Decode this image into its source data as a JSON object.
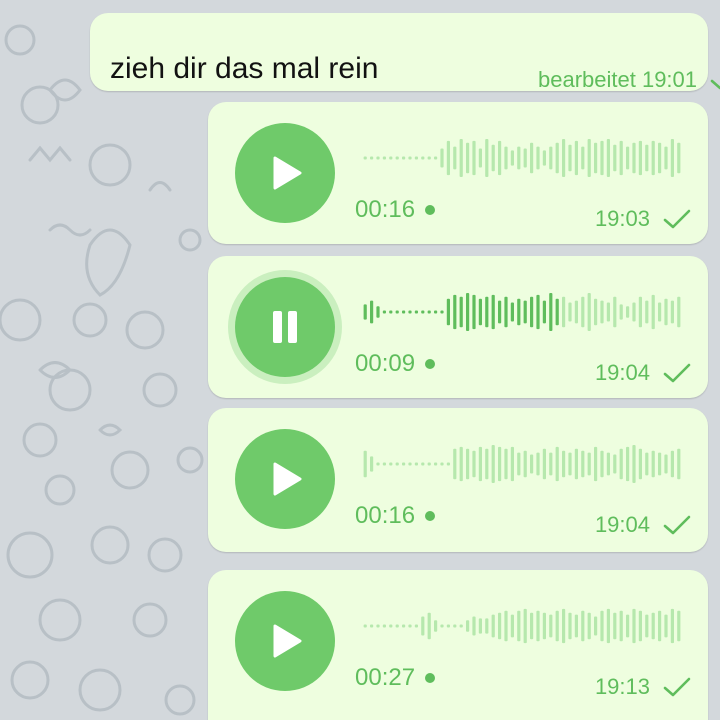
{
  "colors": {
    "background": "#d3d8dc",
    "bubble": "#eefedf",
    "accent": "#6fca6a",
    "meta_text": "#5fbd5c"
  },
  "text_message": {
    "text": "zieh dir das mal rein",
    "status": "bearbeitet 19:01",
    "read_icon": "check-icon"
  },
  "voice_messages": [
    {
      "state": "paused",
      "button_icon": "play-icon",
      "duration": "00:16",
      "time": "19:03",
      "played_fraction": 0.0,
      "unheard": true,
      "read_icon": "check-icon"
    },
    {
      "state": "playing",
      "button_icon": "pause-icon",
      "duration": "00:09",
      "time": "19:04",
      "played_fraction": 0.62,
      "unheard": true,
      "read_icon": "check-icon"
    },
    {
      "state": "paused",
      "button_icon": "play-icon",
      "duration": "00:16",
      "time": "19:04",
      "played_fraction": 0.0,
      "unheard": true,
      "read_icon": "check-icon"
    },
    {
      "state": "paused",
      "button_icon": "play-icon",
      "duration": "00:27",
      "time": "19:13",
      "played_fraction": 0.0,
      "unheard": true,
      "read_icon": "check-icon"
    }
  ]
}
